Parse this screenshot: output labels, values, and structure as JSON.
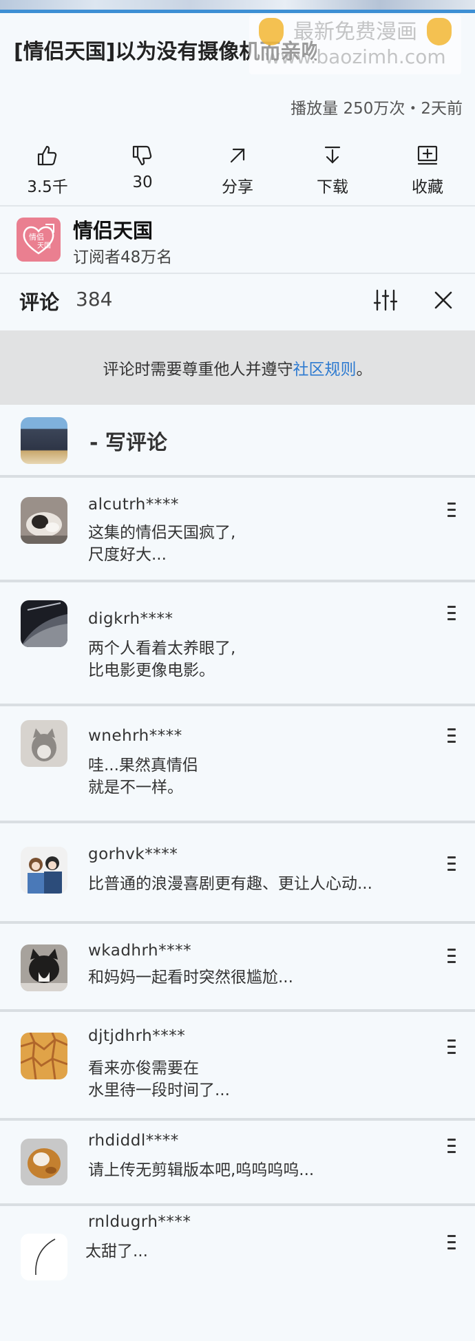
{
  "header": {
    "title": "[情侣天国]以为没有摄像机而亲吻的亦俊♥蔡伊",
    "watermark_line1": "最新免费漫画",
    "watermark_line2": "www.baozimh.com",
    "meta": "播放量 250万次・2天前"
  },
  "actions": [
    {
      "icon": "thumbs-up-icon",
      "label": "3.5千"
    },
    {
      "icon": "thumbs-down-icon",
      "label": "30"
    },
    {
      "icon": "share-icon",
      "label": "分享"
    },
    {
      "icon": "download-icon",
      "label": "下载"
    },
    {
      "icon": "save-playlist-icon",
      "label": "收藏"
    }
  ],
  "channel": {
    "name": "情侣天国",
    "subscribers": "订阅者48万名",
    "logo_text_top": "情侣",
    "logo_text_bottom": "天国"
  },
  "comments_header": {
    "title": "评论",
    "count": "384"
  },
  "notice": {
    "text": "评论时需要尊重他人并遵守",
    "link": "社区规则",
    "end": "。"
  },
  "write_comment": {
    "label": "- 写评论"
  },
  "comments": [
    {
      "user": "alcutrh****",
      "text": "这集的情侣天国疯了,\n尺度好大..."
    },
    {
      "user": "digkrh****",
      "text": "两个人看着太养眼了,\n比电影更像电影。"
    },
    {
      "user": "wnehrh****",
      "text": "哇...果然真情侣\n就是不一样。"
    },
    {
      "user": "gorhvk****",
      "text": "比普通的浪漫喜剧更有趣、更让人心动..."
    },
    {
      "user": "wkadhrh****",
      "text": "和妈妈一起看时突然很尴尬..."
    },
    {
      "user": "djtjdhrh****",
      "text": "看来亦俊需要在\n水里待一段时间了..."
    },
    {
      "user": "rhdiddl****",
      "text": "请上传无剪辑版本吧,呜呜呜呜..."
    },
    {
      "user": "rnldugrh****",
      "text": "太甜了..."
    }
  ],
  "colors": {
    "accent_blue": "#2d7ad0",
    "background": "#f5f9fc",
    "notice_bg": "#e1e2e3",
    "channel_pink": "#ea7f90"
  }
}
